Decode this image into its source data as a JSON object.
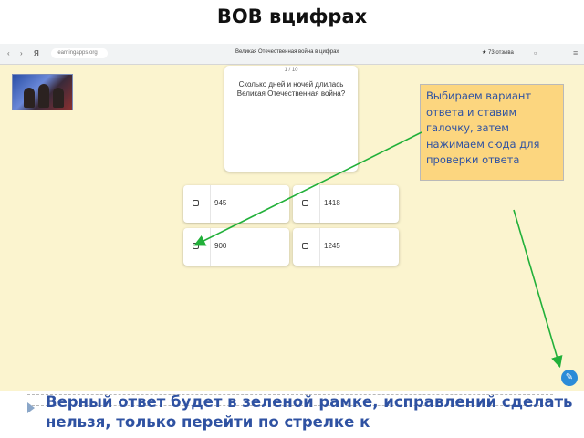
{
  "slide": {
    "title": "ВОВ вцифрах",
    "callout": "Выбираем вариант ответа и ставим галочку, затем нажимаем сюда для проверки ответа",
    "bottom_text": "Верный ответ будет в зеленой рамке, исправлений сделать нельзя, только перейти по стрелке к"
  },
  "browser": {
    "address": "learningapps.org",
    "tab_title": "Великая Отечественная война в цифрах",
    "reviews": "★ 73 отзыва"
  },
  "quiz": {
    "counter": "1 / 10",
    "question": "Сколько дней и ночей длилась Великая Отечественная война?",
    "answers": [
      "945",
      "1418",
      "900",
      "1245"
    ]
  },
  "colors": {
    "background": "#fbf4cf",
    "callout": "#fcd67f",
    "arrow": "#22b03a",
    "text_accent": "#2f52a2",
    "check_button": "#2b8bd8"
  },
  "icons": [
    "back-icon",
    "forward-icon",
    "yandex-icon",
    "lock-icon",
    "menu-icon",
    "check-answer-icon"
  ]
}
